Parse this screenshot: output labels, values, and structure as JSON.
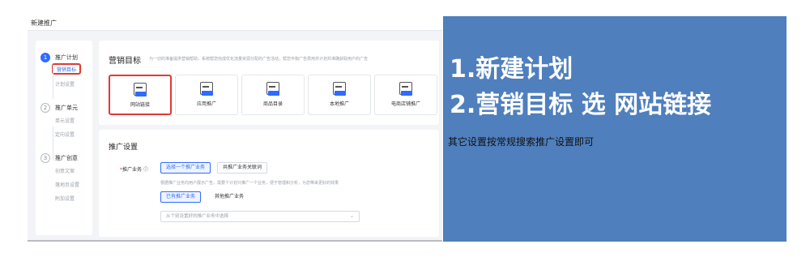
{
  "window": {
    "title": "新建推广"
  },
  "steps": [
    {
      "num": "1",
      "label": "推广计划",
      "subs": [
        "营销目标",
        "计划设置"
      ]
    },
    {
      "num": "2",
      "label": "推广单元",
      "subs": [
        "单元设置",
        "定向设置"
      ]
    },
    {
      "num": "3",
      "label": "推广创意",
      "subs": [
        "创意文案",
        "落地页设置",
        "附加设置"
      ]
    }
  ],
  "goal": {
    "title": "营销目标",
    "description": "为一切的准备提供营销帮助，系统帮您完成优化流量资源分配的广告活动，帮您平衡广告费用并计划并准确获取用户的广告",
    "cards": [
      {
        "label": "网站链接",
        "icon": "website-icon",
        "tag": "WWW"
      },
      {
        "label": "应用推广",
        "icon": "app-icon",
        "tag": "APP"
      },
      {
        "label": "商品目录",
        "icon": "shop-icon",
        "tag": ""
      },
      {
        "label": "本地推广",
        "icon": "store-location-icon",
        "tag": ""
      },
      {
        "label": "电商店铺推广",
        "icon": "ecommerce-icon",
        "tag": ""
      }
    ]
  },
  "settings": {
    "title": "推广设置",
    "business_label": "推广业务",
    "business_info_icon": "info-icon",
    "option_single": "选择一个推广业务",
    "option_shared": "共推广业务关联词",
    "hint": "根据推广业务向用户展示广告，需要个计划只推广一个业务，便于管理和分析，为您带来更好的效果",
    "tab_existing": "已有推广业务",
    "tab_other": "其他推广业务",
    "select_placeholder": "从个别设置好的推广业务中选择"
  },
  "note": {
    "line1": "1.新建计划",
    "line2": "2.营销目标 选 网站链接",
    "line3": "其它设置按常规搜索推广设置即可"
  }
}
